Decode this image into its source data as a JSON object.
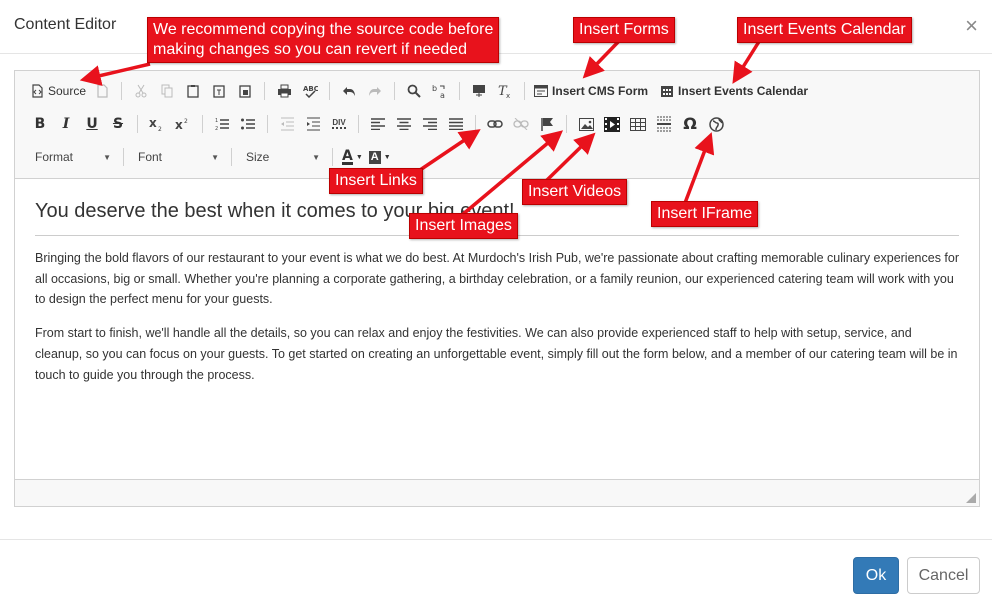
{
  "dialog": {
    "title": "Content Editor",
    "close_glyph": "×"
  },
  "toolbar": {
    "source_label": "Source",
    "insert_cms_form_label": "Insert CMS Form",
    "insert_events_calendar_label": "Insert Events Calendar",
    "format_label": "Format",
    "font_label": "Font",
    "size_label": "Size",
    "bold_glyph": "B",
    "italic_glyph": "I",
    "underline_glyph": "U",
    "strike_glyph": "S",
    "text_color_glyph": "A",
    "bg_color_glyph": "A",
    "special_char_glyph": "Ω",
    "div_glyph": "DIV"
  },
  "content": {
    "heading": "You deserve the best when it comes to your big event!",
    "paragraphs": [
      "Bringing the bold flavors of our restaurant to your event is what we do best. At Murdoch's Irish Pub, we're passionate about crafting memorable culinary experiences for all occasions, big or small. Whether you're planning a corporate gathering, a birthday celebration, or a family reunion, our experienced catering team will work with you to design the perfect menu for your guests.",
      "From start to finish, we'll handle all the details, so you can relax and enjoy the festivities. We can also provide experienced staff to help with setup, service, and cleanup, so you can focus on your guests. To get started on creating an unforgettable event, simply fill out the form below, and a member of our catering team will be in touch to guide you through the process."
    ]
  },
  "footer": {
    "ok_label": "Ok",
    "cancel_label": "Cancel"
  },
  "callouts": {
    "source_note_line1": "We recommend copying the source code before",
    "source_note_line2": "making changes so you can revert if needed",
    "insert_forms": "Insert Forms",
    "insert_events_calendar": "Insert Events Calendar",
    "insert_links": "Insert Links",
    "insert_images": "Insert Images",
    "insert_videos": "Insert Videos",
    "insert_iframe": "Insert IFrame"
  },
  "colors": {
    "accent": "#337ab7",
    "callout": "#e8121c"
  }
}
